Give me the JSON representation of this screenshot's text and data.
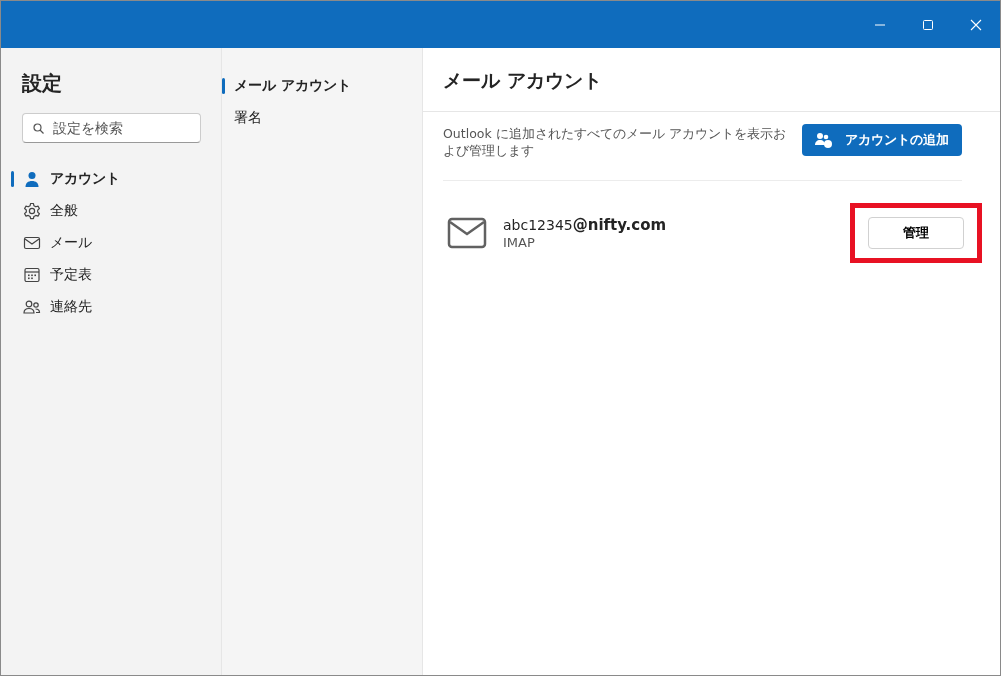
{
  "sidebar": {
    "title": "設定",
    "search": {
      "placeholder": "設定を検索"
    },
    "items": [
      {
        "label": "アカウント",
        "selected": true
      },
      {
        "label": "全般",
        "selected": false
      },
      {
        "label": "メール",
        "selected": false
      },
      {
        "label": "予定表",
        "selected": false
      },
      {
        "label": "連絡先",
        "selected": false
      }
    ]
  },
  "subnav": {
    "items": [
      {
        "label": "メール アカウント",
        "selected": true
      },
      {
        "label": "署名",
        "selected": false
      }
    ]
  },
  "content": {
    "title": "メール アカウント",
    "description": "Outlook に追加されたすべてのメール アカウントを表示および管理します",
    "add_button": "アカウントの追加",
    "accounts": [
      {
        "address": "abc12345**@nifty.com**",
        "type": "IMAP",
        "button": "管理",
        "highlighted": true
      }
    ]
  }
}
